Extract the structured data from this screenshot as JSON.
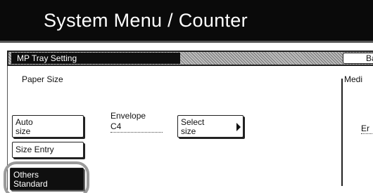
{
  "header": {
    "title": "System Menu / Counter"
  },
  "subbar": {
    "title": "MP Tray Setting",
    "back_label": "Ba"
  },
  "paper_size": {
    "section_label": "Paper Size",
    "auto_size_line1": "Auto",
    "auto_size_line2": "size",
    "envelope_label": "Envelope",
    "envelope_value": "C4",
    "select_size_line1": "Select",
    "select_size_line2": "size",
    "size_entry_label": "Size Entry",
    "others_line1": "Others",
    "others_line2": "Standard"
  },
  "media": {
    "section_label": "Medi",
    "value_fragment": "Er"
  },
  "colors": {
    "title_bg": "#0a0a0a",
    "selected_bg": "#0f0f0f",
    "highlight_ring": "#9a9a9a"
  }
}
